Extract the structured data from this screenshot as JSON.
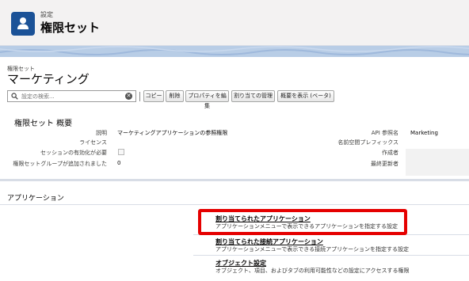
{
  "header": {
    "eyebrow": "設定",
    "title": "権限セット",
    "icon": "user-icon",
    "accent_color": "#1b5297"
  },
  "permission_set": {
    "eyebrow": "権限セット",
    "name": "マーケティング"
  },
  "toolbar": {
    "search_placeholder": "設定の検索...",
    "buttons": {
      "copy": "コピー",
      "delete": "削除",
      "edit_properties": "プロパティを編集",
      "manage_assignments": "割り当ての管理",
      "view_summary": "概要を表示 (ベータ)"
    }
  },
  "overview": {
    "title": "権限セット 概要",
    "fields": {
      "description_label": "説明",
      "description_value": "マーケティングアプリケーションの参照権限",
      "license_label": "ライセンス",
      "license_value": "",
      "session_label": "セッションの有効化が必要",
      "group_label": "権限セットグループが追加されました",
      "group_value": "0",
      "api_label": "API 参照名",
      "api_value": "Marketing",
      "namespace_label": "名前空間プレフィックス",
      "created_label": "作成者",
      "modified_label": "最終更新者"
    }
  },
  "apps": {
    "title": "アプリケーション",
    "items": [
      {
        "title": "割り当てられたアプリケーション",
        "desc": "アプリケーションメニューで表示できるアプリケーションを指定する設定"
      },
      {
        "title": "割り当てられた接続アプリケーション",
        "desc": "アプリケーションメニューで表示できる接続アプリケーションを指定する設定"
      },
      {
        "title": "オブジェクト設定",
        "desc": "オブジェクト、項目、およびタブの利用可能性などの設定にアクセスする権限"
      }
    ],
    "highlight_color": "#e50000"
  }
}
